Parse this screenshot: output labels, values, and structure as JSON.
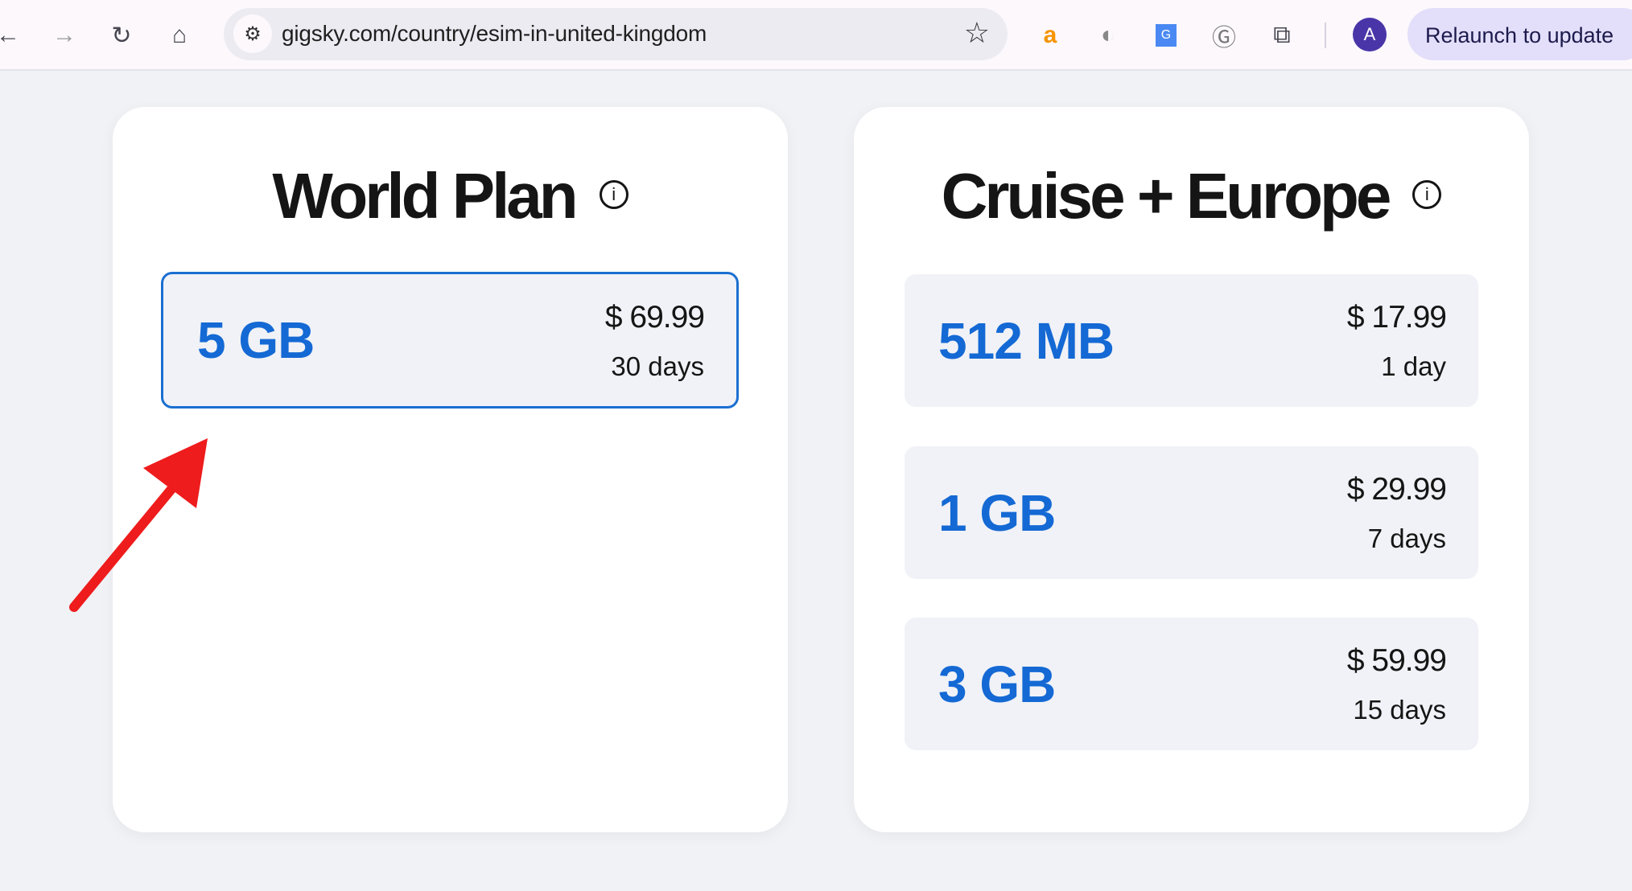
{
  "browser": {
    "url": "gigsky.com/country/esim-in-united-kingdom",
    "relaunch_label": "Relaunch to update",
    "avatar_letter": "A",
    "icons": [
      "back-icon",
      "forward-icon",
      "reload-icon",
      "home-icon",
      "site-settings-icon",
      "bookmark-star-icon",
      "amazon-extension-icon",
      "extension-icon",
      "google-translate-icon",
      "grammarly-icon",
      "extensions-puzzle-icon"
    ]
  },
  "plans": [
    {
      "title": "World Plan",
      "options": [
        {
          "data": "5 GB",
          "price": "$ 69.99",
          "duration": "30 days",
          "selected": true
        }
      ]
    },
    {
      "title": "Cruise + Europe",
      "options": [
        {
          "data": "512 MB",
          "price": "$ 17.99",
          "duration": "1 day"
        },
        {
          "data": "1 GB",
          "price": "$ 29.99",
          "duration": "7 days"
        },
        {
          "data": "3 GB",
          "price": "$ 59.99",
          "duration": "15 days"
        }
      ]
    }
  ],
  "colors": {
    "accent": "#1469d4",
    "annotation_arrow": "#ee1c1c"
  }
}
